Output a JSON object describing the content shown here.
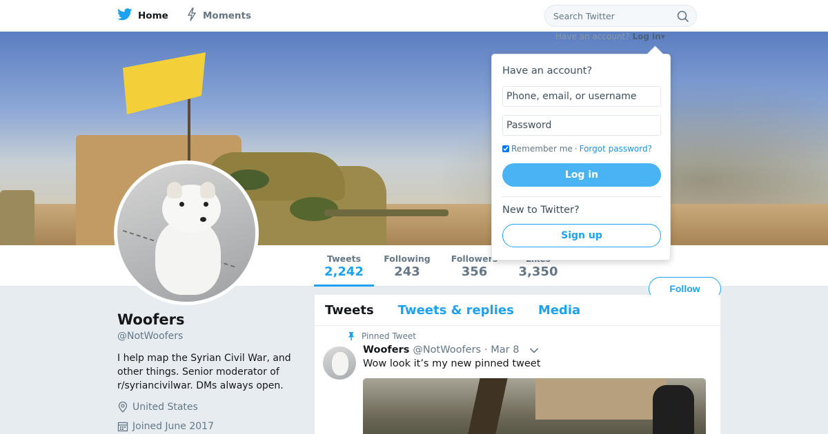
{
  "topnav": {
    "home_label": "Home",
    "moments_label": "Moments",
    "search_placeholder": "Search Twitter",
    "login_hint_prefix": "Have an account?",
    "login_hint_link": "Log in"
  },
  "profile_nav": {
    "stats": [
      {
        "label": "Tweets",
        "value": "2,242"
      },
      {
        "label": "Following",
        "value": "243"
      },
      {
        "label": "Followers",
        "value": "356"
      },
      {
        "label": "Likes",
        "value": "3,350"
      }
    ],
    "follow_label": "Follow"
  },
  "profile": {
    "name": "Woofers",
    "handle": "@NotWoofers",
    "bio": "I help map the Syrian Civil War, and other things. Senior moderator of r/syriancivilwar. DMs always open.",
    "location": "United States",
    "joined": "Joined June 2017"
  },
  "timeline": {
    "tabs": [
      "Tweets",
      "Tweets & replies",
      "Media"
    ],
    "pinned_label": "Pinned Tweet",
    "tweet": {
      "name": "Woofers",
      "handle": "@NotWoofers",
      "time": "· Mar 8",
      "text": "Wow look it’s my new pinned tweet"
    }
  },
  "login_dropdown": {
    "title": "Have an account?",
    "username_placeholder": "Phone, email, or username",
    "password_placeholder": "Password",
    "remember_label": "Remember me",
    "separator": "·",
    "forgot_label": "Forgot password?",
    "login_button": "Log in",
    "new_label": "New to Twitter?",
    "signup_button": "Sign up"
  },
  "colors": {
    "accent": "#1da1f2",
    "login_button": "#4ab3f4",
    "background": "#e6ecf0"
  }
}
